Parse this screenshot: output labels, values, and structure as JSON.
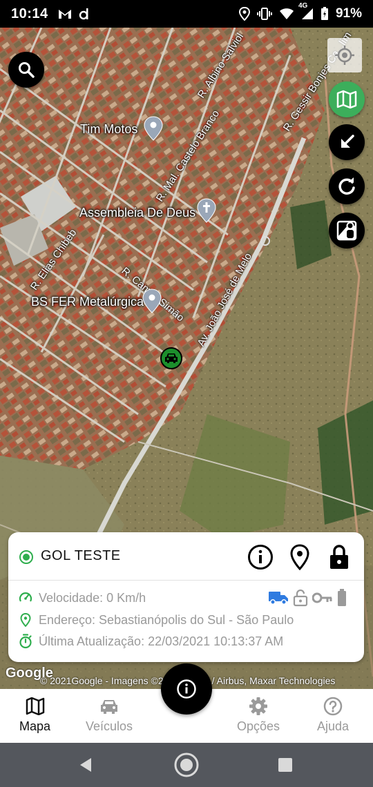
{
  "status_bar": {
    "time": "10:14",
    "battery": "91%",
    "network": "4G",
    "icons": [
      "gmail-icon",
      "d-app-icon",
      "location-icon",
      "vibrate-icon",
      "wifi-icon",
      "signal-icon",
      "battery-icon"
    ]
  },
  "map": {
    "labels": {
      "tim_motos": "Tim Motos",
      "assembleia": "Assembleia De Deus",
      "bs_fer": "BS FER Metalúrgica",
      "road_albino": "R. Albino Salviol",
      "road_gessir": "R. Gessir Bonjes Ca...lim",
      "road_castelo": "R. Mal. Castelo Branco",
      "road_camilo": "R. Camilo Simão",
      "road_elias": "R. Elias Chibeb",
      "road_joao": "Av. João José de Melo"
    },
    "google_logo": "Google",
    "copyright": "© 2021Google - Imagens ©2021 CNES / Airbus, Maxar Technologies",
    "buttons": [
      "search-icon",
      "my-location-icon",
      "map-type-icon",
      "arrow-down-left-icon",
      "refresh-icon",
      "street-view-icon"
    ]
  },
  "card": {
    "vehicle_name": "GOL TESTE",
    "status_color": "#2fae4e",
    "speed": "Velocidade: 0 Km/h",
    "address": "Endereço: Sebastianópolis do Sul - São Paulo",
    "last_update": "Última Atualização: 22/03/2021 10:13:37 AM",
    "head_icons": [
      "info-icon",
      "location-pin-icon",
      "lock-icon"
    ],
    "status_icons": [
      "truck-icon",
      "unlock-icon",
      "key-icon",
      "battery-icon"
    ]
  },
  "bottom_nav": {
    "items": [
      {
        "label": "Mapa",
        "icon": "map-icon",
        "active": true
      },
      {
        "label": "Veículos",
        "icon": "car-icon",
        "active": false
      },
      {
        "label": "Opções",
        "icon": "gear-icon",
        "active": false
      },
      {
        "label": "Ajuda",
        "icon": "help-icon",
        "active": false
      }
    ],
    "center_icon": "info-icon"
  },
  "colors": {
    "accent_green": "#3cae5b",
    "truck_blue": "#2f7be0",
    "car_marker": "#1c8f2c"
  }
}
